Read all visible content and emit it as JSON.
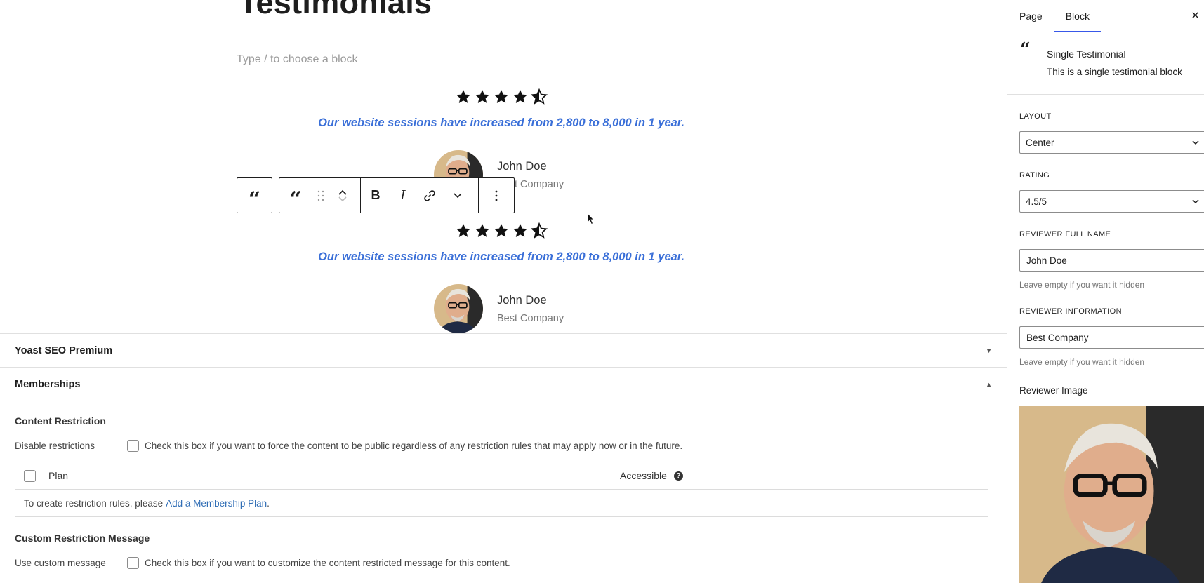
{
  "editor": {
    "title": "Testimonials",
    "placeholder": "Type / to choose a block",
    "testimonials": [
      {
        "rating": 4.5,
        "quote": "Our website sessions have increased from 2,800 to 8,000 in 1 year.",
        "name": "John Doe",
        "company": "Best Company"
      },
      {
        "rating": 4.5,
        "quote": "Our website sessions have increased from 2,800 to 8,000 in 1 year.",
        "name": "John Doe",
        "company": "Best Company"
      }
    ],
    "toolbar": {
      "bold": "B",
      "italic": "I"
    }
  },
  "meta": {
    "yoast": "Yoast SEO Premium",
    "memberships": "Memberships",
    "content_restriction": "Content Restriction",
    "disable_restrictions_label": "Disable restrictions",
    "disable_restrictions_text": "Check this box if you want to force the content to be public regardless of any restriction rules that may apply now or in the future.",
    "plan_header": "Plan",
    "accessible_header": "Accessible",
    "create_rules_text": "To create restriction rules, please",
    "add_plan_link": "Add a Membership Plan",
    "custom_message_heading": "Custom Restriction Message",
    "use_custom_label": "Use custom message",
    "use_custom_text": "Check this box if you want to customize the content restricted message for this content."
  },
  "sidebar": {
    "tabs": [
      "Page",
      "Block"
    ],
    "active_tab": "Block",
    "block_name": "Single Testimonial",
    "block_desc": "This is a single testimonial block",
    "layout_label": "Layout",
    "layout_value": "Center",
    "rating_label": "Rating",
    "rating_value": "4.5/5",
    "reviewer_name_label": "Reviewer Full Name",
    "reviewer_name_value": "John Doe",
    "reviewer_name_help": "Leave empty if you want it hidden",
    "reviewer_info_label": "Reviewer Information",
    "reviewer_info_value": "Best Company",
    "reviewer_info_help": "Leave empty if you want it hidden",
    "reviewer_image_label": "Reviewer Image"
  },
  "colors": {
    "quote_blue": "#3a6fd8",
    "link_blue": "#2f6db5",
    "active_tab_underline": "#3858e9"
  }
}
